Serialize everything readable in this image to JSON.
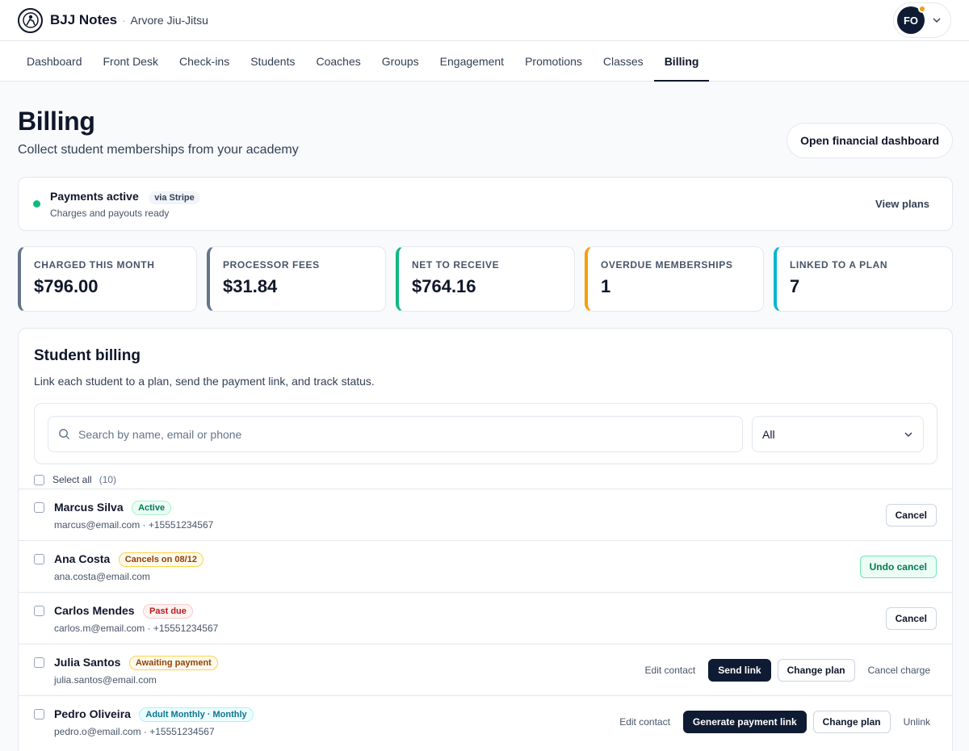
{
  "app": {
    "name": "BJJ Notes",
    "academy": "Arvore Jiu-Jitsu",
    "user_initials": "FO"
  },
  "nav": [
    "Dashboard",
    "Front Desk",
    "Check-ins",
    "Students",
    "Coaches",
    "Groups",
    "Engagement",
    "Promotions",
    "Classes",
    "Billing"
  ],
  "nav_active": "Billing",
  "header": {
    "title": "Billing",
    "subtitle": "Collect student memberships from your academy",
    "financial_button": "Open financial dashboard"
  },
  "payments": {
    "title": "Payments active",
    "provider": "via Stripe",
    "subtitle": "Charges and payouts ready",
    "view_plans": "View plans"
  },
  "stats": [
    {
      "label": "CHARGED THIS MONTH",
      "value": "$796.00",
      "color": "#64748b"
    },
    {
      "label": "PROCESSOR FEES",
      "value": "$31.84",
      "color": "#64748b"
    },
    {
      "label": "NET TO RECEIVE",
      "value": "$764.16",
      "color": "#10b981"
    },
    {
      "label": "OVERDUE MEMBERSHIPS",
      "value": "1",
      "color": "#f59e0b"
    },
    {
      "label": "LINKED TO A PLAN",
      "value": "7",
      "color": "#06b6d4"
    }
  ],
  "student_billing": {
    "title": "Student billing",
    "subtitle": "Link each student to a plan, send the payment link, and track status.",
    "search_placeholder": "Search by name, email or phone",
    "filter_value": "All",
    "select_all": "Select all",
    "count": "(10)",
    "rows": [
      {
        "name": "Marcus Silva",
        "badge": "Active",
        "contact": "marcus@email.com · +15551234567",
        "actions": {
          "cancel": "Cancel"
        }
      },
      {
        "name": "Ana Costa",
        "badge": "Cancels on 08/12",
        "contact": "ana.costa@email.com",
        "actions": {
          "undo": "Undo cancel"
        }
      },
      {
        "name": "Carlos Mendes",
        "badge": "Past due",
        "contact": "carlos.m@email.com · +15551234567",
        "actions": {
          "cancel": "Cancel"
        }
      },
      {
        "name": "Julia Santos",
        "badge": "Awaiting payment",
        "contact": "julia.santos@email.com",
        "actions": {
          "edit": "Edit contact",
          "send": "Send link",
          "change": "Change plan",
          "cancel_charge": "Cancel charge"
        }
      },
      {
        "name": "Pedro Oliveira",
        "badge": "Adult Monthly · Monthly",
        "contact": "pedro.o@email.com · +15551234567",
        "actions": {
          "edit": "Edit contact",
          "generate": "Generate payment link",
          "change": "Change plan",
          "unlink": "Unlink"
        }
      }
    ]
  }
}
